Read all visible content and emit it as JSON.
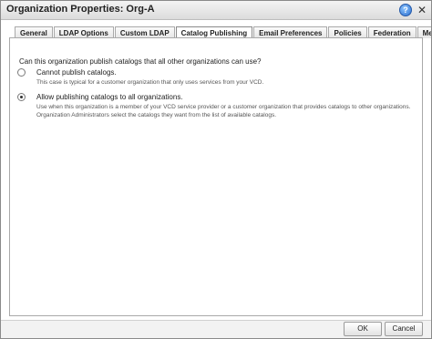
{
  "dialog": {
    "title": "Organization Properties: Org-A"
  },
  "tabs": [
    {
      "label": "General"
    },
    {
      "label": "LDAP Options"
    },
    {
      "label": "Custom LDAP"
    },
    {
      "label": "Catalog Publishing"
    },
    {
      "label": "Email Preferences"
    },
    {
      "label": "Policies"
    },
    {
      "label": "Federation"
    },
    {
      "label": "Metadata"
    }
  ],
  "active_tab": "Catalog Publishing",
  "catalog": {
    "question": "Can this organization publish catalogs that all other organizations can use?",
    "options": [
      {
        "label": "Cannot publish catalogs.",
        "description": "This case is typical for a customer organization that only uses services from your VCD.",
        "selected": false
      },
      {
        "label": "Allow publishing catalogs to all organizations.",
        "description": "Use when this organization is a member of your VCD service provider or a customer organization that provides catalogs to other organizations. Organization Administrators select the catalogs they want from the list of available catalogs.",
        "selected": true
      }
    ]
  },
  "buttons": {
    "ok": "OK",
    "cancel": "Cancel"
  },
  "icons": {
    "help": "help-icon",
    "close": "close-icon"
  }
}
